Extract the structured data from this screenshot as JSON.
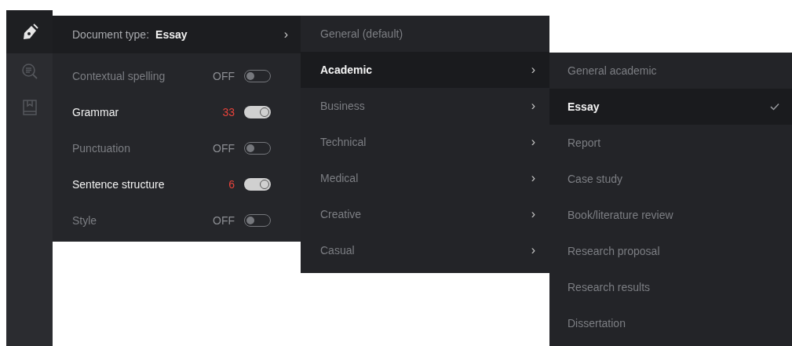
{
  "sidebar": {
    "items": [
      {
        "kind": "pen",
        "selected": true
      },
      {
        "kind": "search",
        "selected": false
      },
      {
        "kind": "book",
        "selected": false
      }
    ]
  },
  "settings_panel": {
    "document_type": {
      "label": "Document type:",
      "value": "Essay",
      "chevron": "›"
    },
    "checks": [
      {
        "label": "Contextual spelling",
        "reading": "OFF",
        "on": false
      },
      {
        "label": "Grammar",
        "reading": "33",
        "on": true
      },
      {
        "label": "Punctuation",
        "reading": "OFF",
        "on": false
      },
      {
        "label": "Sentence structure",
        "reading": "6",
        "on": true
      },
      {
        "label": "Style",
        "reading": "OFF",
        "on": false
      }
    ]
  },
  "type_menu": {
    "items": [
      {
        "label": "General (default)",
        "selected": false,
        "submenu": false
      },
      {
        "label": "Academic",
        "selected": true,
        "submenu": true
      },
      {
        "label": "Business",
        "selected": false,
        "submenu": true
      },
      {
        "label": "Technical",
        "selected": false,
        "submenu": true
      },
      {
        "label": "Medical",
        "selected": false,
        "submenu": true
      },
      {
        "label": "Creative",
        "selected": false,
        "submenu": true
      },
      {
        "label": "Casual",
        "selected": false,
        "submenu": true
      }
    ],
    "chevron": "›"
  },
  "academic_menu": {
    "items": [
      {
        "label": "General academic",
        "selected": false
      },
      {
        "label": "Essay",
        "selected": true
      },
      {
        "label": "Report",
        "selected": false
      },
      {
        "label": "Case study",
        "selected": false
      },
      {
        "label": "Book/literature review",
        "selected": false
      },
      {
        "label": "Research proposal",
        "selected": false
      },
      {
        "label": "Research results",
        "selected": false
      },
      {
        "label": "Dissertation",
        "selected": false
      }
    ]
  }
}
